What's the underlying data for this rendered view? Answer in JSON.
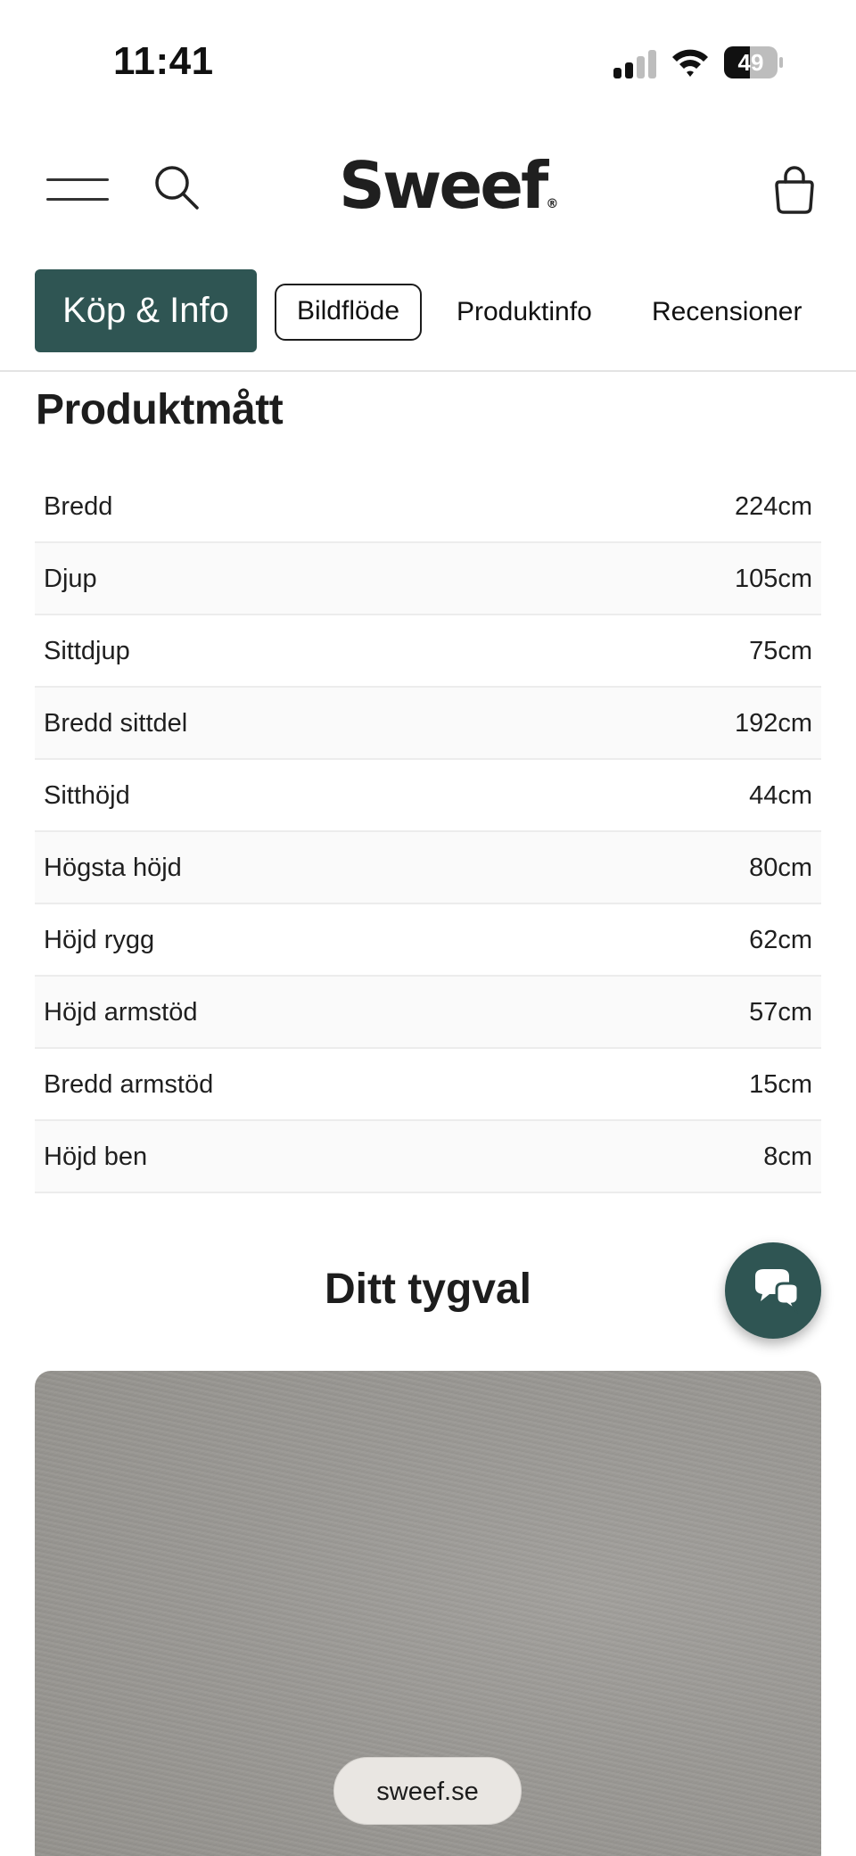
{
  "status_bar": {
    "time": "11:41",
    "battery_level": "49",
    "signal_icon": "cellular-signal-icon",
    "wifi_icon": "wifi-icon"
  },
  "header": {
    "logo_text": "Sweef",
    "logo_mark": "®",
    "menu_icon": "hamburger-menu-icon",
    "search_icon": "search-icon",
    "cart_icon": "shopping-bag-icon"
  },
  "tabs": {
    "primary": "Köp & Info",
    "items": [
      "Bildflöde",
      "Produktinfo",
      "Recensioner"
    ]
  },
  "dimensions": {
    "title": "Produktmått",
    "rows": [
      {
        "label": "Bredd",
        "value": "224cm"
      },
      {
        "label": "Djup",
        "value": "105cm"
      },
      {
        "label": "Sittdjup",
        "value": "75cm"
      },
      {
        "label": "Bredd sittdel",
        "value": "192cm"
      },
      {
        "label": "Sitthöjd",
        "value": "44cm"
      },
      {
        "label": "Högsta höjd",
        "value": "80cm"
      },
      {
        "label": "Höjd rygg",
        "value": "62cm"
      },
      {
        "label": "Höjd armstöd",
        "value": "57cm"
      },
      {
        "label": "Bredd armstöd",
        "value": "15cm"
      },
      {
        "label": "Höjd ben",
        "value": "8cm"
      }
    ]
  },
  "fabric": {
    "title": "Ditt tygval",
    "swatch_color": "#9e9c98"
  },
  "chat": {
    "icon": "chat-bubbles-icon",
    "color": "#2f5553"
  },
  "browser": {
    "url": "sweef.se"
  },
  "colors": {
    "accent": "#2f5553",
    "text": "#222222"
  }
}
